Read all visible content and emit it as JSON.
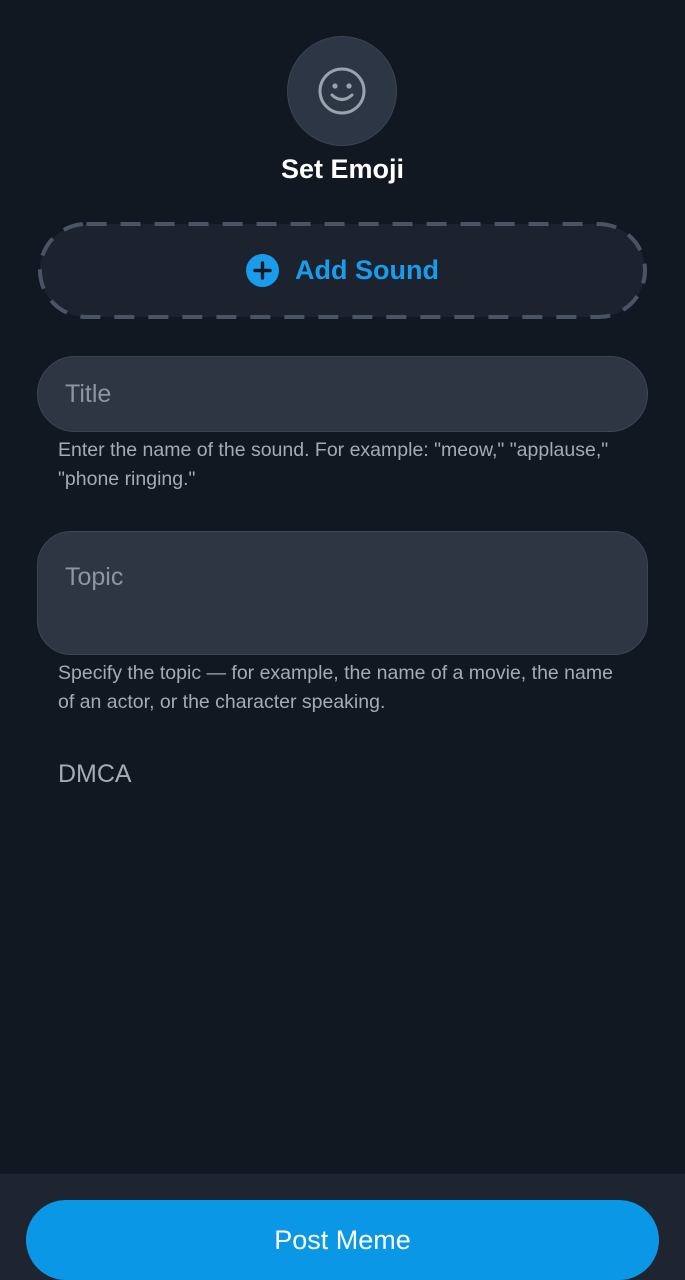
{
  "emoji": {
    "icon": "smiley-face-icon",
    "label": "Set Emoji"
  },
  "add_sound": {
    "icon": "plus-circle-icon",
    "label": "Add Sound"
  },
  "title_field": {
    "value": "",
    "placeholder": "Title",
    "hint": "Enter the name of the sound. For example: \"meow,\" \"applause,\" \"phone ringing.\""
  },
  "topic_field": {
    "value": "",
    "placeholder": "Topic",
    "hint": "Specify the topic — for example, the name of a movie, the name of an actor, or the character speaking."
  },
  "dmca_label": "DMCA",
  "post_button": {
    "label": "Post Meme"
  },
  "colors": {
    "background": "#121821",
    "accent": "#0a98e6",
    "link": "#1a9cec",
    "field": "#2e3644"
  }
}
